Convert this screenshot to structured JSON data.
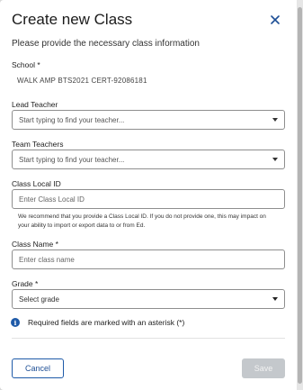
{
  "dialog": {
    "title": "Create new Class",
    "subtitle": "Please provide the necessary class information"
  },
  "form": {
    "school": {
      "label": "School *",
      "value": "WALK AMP BTS2021 CERT-92086181"
    },
    "lead_teacher": {
      "label": "Lead Teacher",
      "placeholder": "Start typing to find your teacher..."
    },
    "team_teachers": {
      "label": "Team Teachers",
      "placeholder": "Start typing to find your teacher..."
    },
    "class_local_id": {
      "label": "Class Local ID",
      "placeholder": "Enter Class Local ID",
      "help": "We recommend that you provide a Class Local ID. If you do not provide one, this may impact on your ability to import or export data to or from Ed."
    },
    "class_name": {
      "label": "Class Name *",
      "placeholder": "Enter class name"
    },
    "grade": {
      "label": "Grade *",
      "selected": "Select grade"
    },
    "required_note": "Required fields are marked with an asterisk (*)"
  },
  "footer": {
    "cancel_label": "Cancel",
    "save_label": "Save"
  },
  "colors": {
    "accent": "#1e5aa8",
    "disabled": "#c4c8cc"
  },
  "icons": {
    "close": "close-icon",
    "info": "info-icon",
    "dropdown": "chevron-down-icon"
  }
}
